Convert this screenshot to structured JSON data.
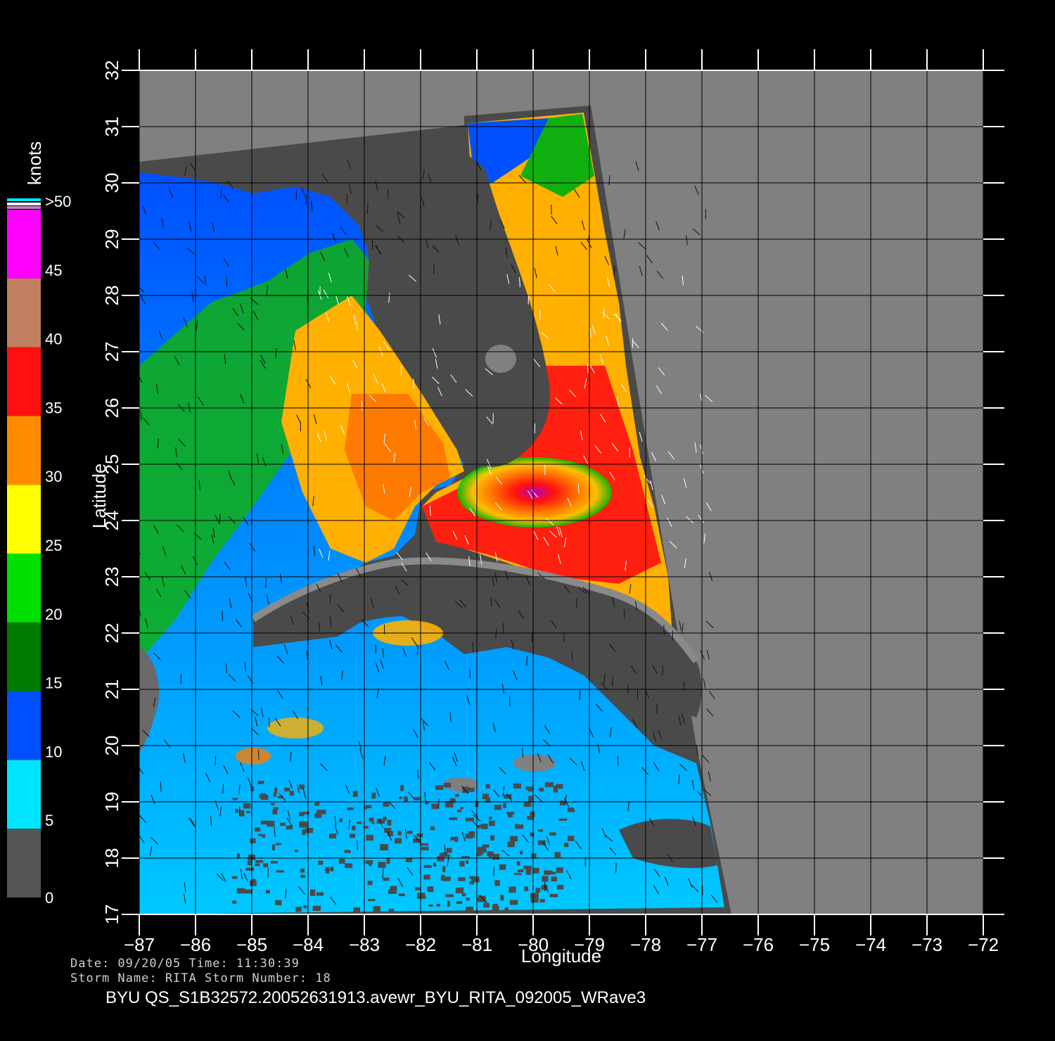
{
  "map": {
    "x_axis_label": "Longitude",
    "y_axis_label": "Latitude",
    "lon_ticks": [
      "-87",
      "-86",
      "-85",
      "-84",
      "-83",
      "-82",
      "-81",
      "-80",
      "-79",
      "-78",
      "-77",
      "-76",
      "-75",
      "-74",
      "-73",
      "-72"
    ],
    "lat_ticks": [
      "17",
      "18",
      "19",
      "20",
      "21",
      "22",
      "23",
      "24",
      "25",
      "26",
      "27",
      "28",
      "29",
      "30",
      "31",
      "32"
    ],
    "lon_range": [
      -87,
      -72
    ],
    "lat_range": [
      17,
      32
    ],
    "grid": true,
    "land_color": "#4a4a4a",
    "coast_color": "#8a8a8a",
    "background_color": "#808080"
  },
  "colorbar": {
    "unit_label": "knots",
    "tick_labels": [
      "0",
      "5",
      "10",
      "15",
      "20",
      "25",
      "30",
      "35",
      "40",
      "45",
      ">50"
    ],
    "colors": [
      "#808080",
      "#00e5ff",
      "#0050ff",
      "#007a00",
      "#00e000",
      "#ffff00",
      "#ff8c00",
      "#ff1010",
      "#c08060",
      "#ff00ff",
      "#8800cc"
    ]
  },
  "info": {
    "line1": "Date: 09/20/05   Time: 11:30:39",
    "line2": "Storm  Name: RITA   Storm  Number: 18",
    "filename": "BYU  QS_S1B32572.20052631913.avewr_BYU_RITA_092005_WRave3"
  }
}
